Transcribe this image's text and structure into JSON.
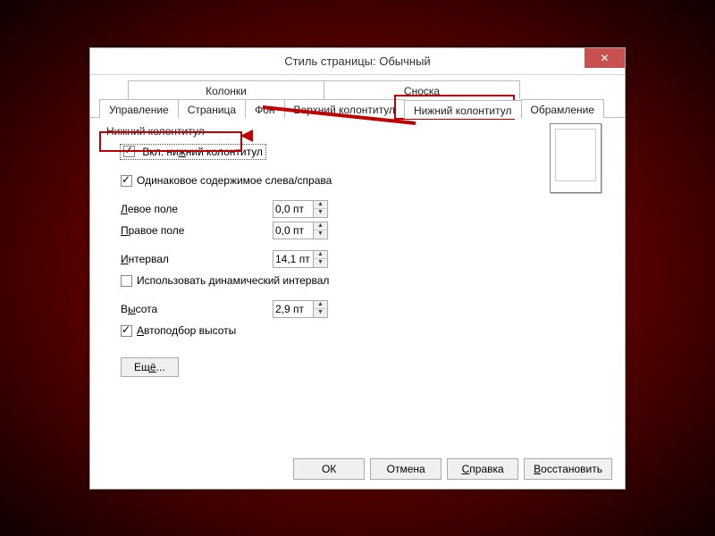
{
  "title": "Стиль страницы: Обычный",
  "tabs_top": [
    "Колонки",
    "Сноска"
  ],
  "tabs_bottom": [
    "Управление",
    "Страница",
    "Фон",
    "Верхний колонтитул",
    "Нижний колонтитул",
    "Обрамление"
  ],
  "active_tab": "Нижний колонтитул",
  "group_label": "Нижний колонтитул",
  "enable_label": "Вкл. нижний колонтитул",
  "same_label": "Одинаковое содержимое слева/справа",
  "left_margin_label": "Левое поле",
  "right_margin_label": "Правое поле",
  "spacing_label": "Интервал",
  "dynamic_label": "Использовать динамический интервал",
  "height_label": "Высота",
  "autofit_label": "Автоподбор высоты",
  "more_label": "Ещё...",
  "values": {
    "left": "0,0 пт",
    "right": "0,0 пт",
    "spacing": "14,1 пт",
    "height": "2,9 пт"
  },
  "checks": {
    "enable": true,
    "same": true,
    "dynamic": false,
    "autofit": true
  },
  "buttons": {
    "ok": "ОК",
    "cancel": "Отмена",
    "help": "Справка",
    "reset": "Восстановить"
  }
}
